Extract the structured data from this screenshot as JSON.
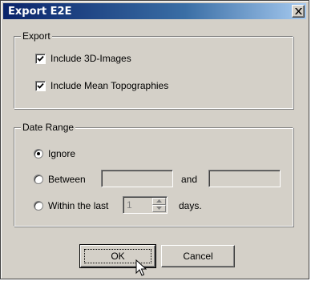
{
  "window": {
    "title": "Export E2E",
    "close_icon": "close-icon"
  },
  "export_group": {
    "legend": "Export",
    "include_3d_images": {
      "label": "Include 3D-Images",
      "checked": true
    },
    "include_mean_topographies": {
      "label": "Include Mean Topographies",
      "checked": true
    }
  },
  "date_range_group": {
    "legend": "Date Range",
    "ignore": {
      "label": "Ignore",
      "selected": true
    },
    "between": {
      "label": "Between",
      "selected": false,
      "from_value": "",
      "and_label": "and",
      "to_value": ""
    },
    "within_last": {
      "label": "Within the last",
      "selected": false,
      "value": "1",
      "unit_label": "days."
    }
  },
  "buttons": {
    "ok_label": "OK",
    "cancel_label": "Cancel"
  },
  "colors": {
    "title_gradient_start": "#0a246a",
    "title_gradient_end": "#a6caf0",
    "face": "#d4d0c8"
  }
}
